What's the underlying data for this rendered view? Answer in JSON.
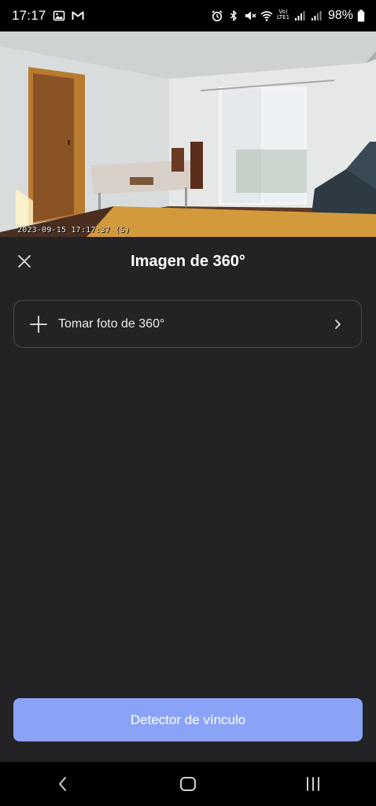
{
  "status_bar": {
    "time": "17:17",
    "battery": "98%",
    "network": "Vo) LTE1",
    "icons": [
      "image-icon",
      "gmail-icon",
      "alarm-icon",
      "bluetooth-icon",
      "mute-icon",
      "wifi-icon",
      "lte-icon",
      "signal-icon",
      "signal-icon",
      "battery-icon"
    ]
  },
  "camera": {
    "timestamp": "2023-09-15 17:17:37  (S)"
  },
  "header": {
    "title": "Imagen de 360°",
    "close_icon": "close-icon"
  },
  "take_photo": {
    "label": "Tomar foto de 360°",
    "icon": "plus-icon",
    "chevron": "chevron-right-icon"
  },
  "primary_button": {
    "label": "Detector de vínculo",
    "color": "#8aa3f6"
  },
  "nav_bar": {
    "back_icon": "back-icon",
    "home_icon": "home-icon",
    "recents_icon": "recents-icon"
  },
  "colors": {
    "background": "#232326",
    "card_border": "#4a4a4e",
    "accent": "#8aa3f6"
  }
}
